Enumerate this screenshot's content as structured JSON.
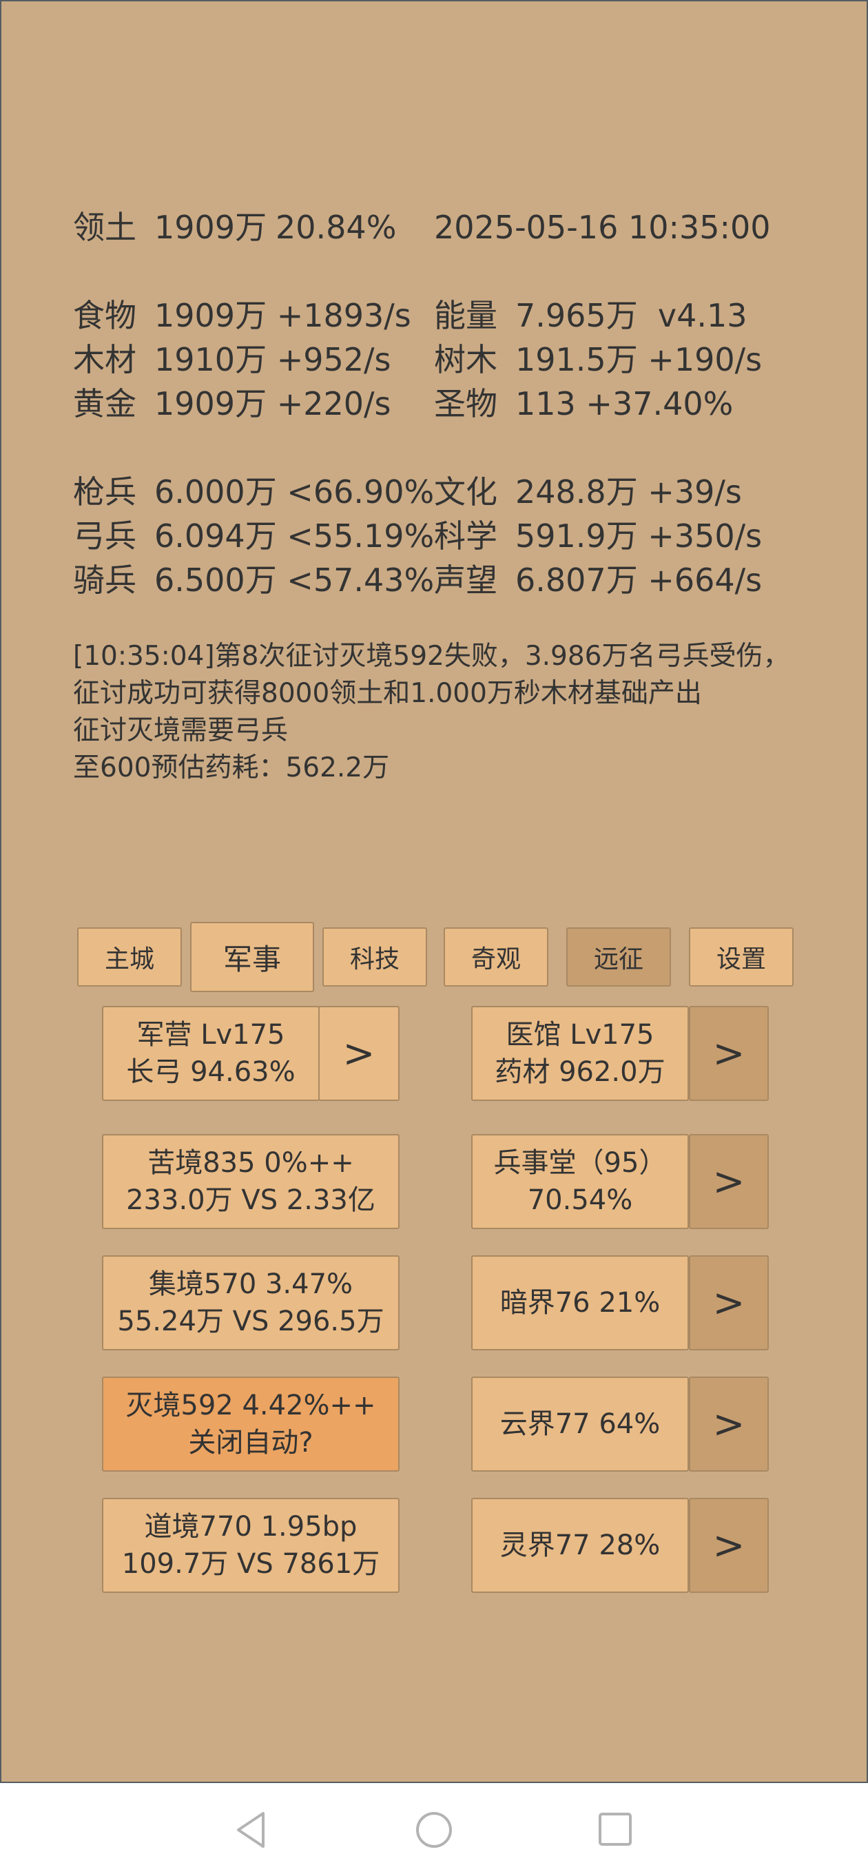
{
  "header": {
    "territory_label": "领土",
    "territory_value": "1909万",
    "territory_pct": "20.84%",
    "datetime": "2025-05-16 10:35:00"
  },
  "resources": {
    "food": {
      "label": "食物",
      "value": "1909万 +1893/s"
    },
    "energy": {
      "label": "能量",
      "value": "7.965万  v4.13"
    },
    "wood": {
      "label": "木材",
      "value": "1910万 +952/s"
    },
    "tree": {
      "label": "树木",
      "value": "191.5万 +190/s"
    },
    "gold": {
      "label": "黄金",
      "value": "1909万 +220/s"
    },
    "relic": {
      "label": "圣物",
      "value": "113 +37.40%"
    }
  },
  "troops": {
    "spear": {
      "label": "枪兵",
      "value": "6.000万 <66.90%"
    },
    "culture": {
      "label": "文化",
      "value": "248.8万 +39/s"
    },
    "archer": {
      "label": "弓兵",
      "value": "6.094万 <55.19%"
    },
    "science": {
      "label": "科学",
      "value": "591.9万 +350/s"
    },
    "cavalry": {
      "label": "骑兵",
      "value": "6.500万 <57.43%"
    },
    "prestige": {
      "label": "声望",
      "value": "6.807万 +664/s"
    }
  },
  "log": {
    "line1": "[10:35:04]第8次征讨灭境592失败，3.986万名弓兵受伤，征讨成功可获得8000领土和1.000万秒木材基础产出",
    "line2": "征讨灭境需要弓兵",
    "line3": "至600预估药耗：562.2万"
  },
  "tabs": [
    "主城",
    "军事",
    "科技",
    "奇观",
    "远征",
    "设置"
  ],
  "buttons": {
    "barracks": {
      "line1": "军营 Lv175",
      "line2": "长弓 94.63%"
    },
    "hospital": {
      "line1": "医馆 Lv175",
      "line2": "药材 962.0万"
    },
    "ku": {
      "line1": "苦境835  0%++",
      "line2": "233.0万 VS 2.33亿"
    },
    "military_hall": {
      "line1": "兵事堂（95）",
      "line2": "70.54%"
    },
    "ji": {
      "line1": "集境570  3.47%",
      "line2": "55.24万 VS 296.5万"
    },
    "an": {
      "line1": "暗界76  21%"
    },
    "mie": {
      "line1": "灭境592  4.42%++",
      "line2": "关闭自动?"
    },
    "yun": {
      "line1": "云界77  64%"
    },
    "dao": {
      "line1": "道境770  1.95bp",
      "line2": "109.7万 VS 7861万"
    },
    "ling": {
      "line1": "灵界77  28%"
    },
    "arrow": ">"
  },
  "colors": {
    "background": "#cbab85",
    "button": "#e9bb86",
    "button_dark": "#c79e70",
    "button_highlight": "#eba462"
  },
  "navbar": {
    "back": "back-icon",
    "home": "home-icon",
    "recents": "recents-icon"
  }
}
